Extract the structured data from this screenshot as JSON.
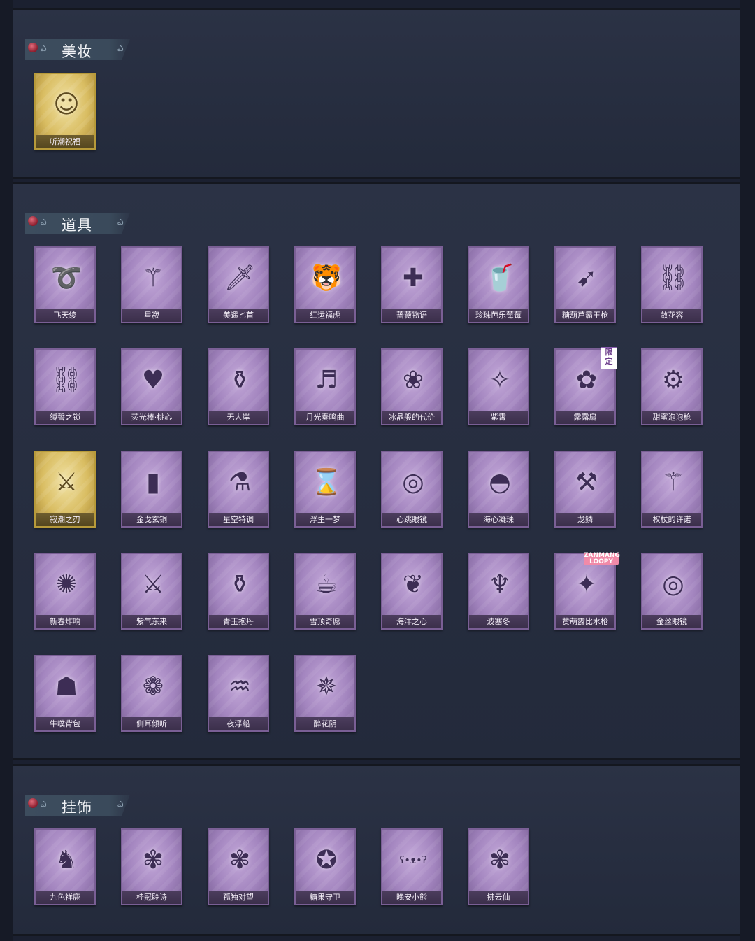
{
  "colors": {
    "background": "#1b2030",
    "panel": "#2b3245",
    "card_purple": "#a385bf",
    "card_gold": "#d9bd62"
  },
  "sections": [
    {
      "title": "美妆",
      "items": [
        {
          "name": "听潮祝福",
          "rarity": "gold",
          "icon": "face-icon"
        }
      ]
    },
    {
      "title": "道具",
      "items": [
        {
          "name": "飞天绫",
          "rarity": "purple",
          "icon": "ribbon-icon"
        },
        {
          "name": "星寂",
          "rarity": "purple",
          "icon": "scepter-icon"
        },
        {
          "name": "美遥匕首",
          "rarity": "purple",
          "icon": "dagger-icon"
        },
        {
          "name": "红运福虎",
          "rarity": "purple",
          "icon": "tiger-icon"
        },
        {
          "name": "蔷薇物语",
          "rarity": "purple",
          "icon": "medkit-icon"
        },
        {
          "name": "珍珠芭乐莓莓",
          "rarity": "purple",
          "icon": "drink-icon"
        },
        {
          "name": "糖葫芦霸王枪",
          "rarity": "purple",
          "icon": "spear-icon"
        },
        {
          "name": "敛花容",
          "rarity": "purple",
          "icon": "chain-icon"
        },
        {
          "name": "缚誓之锁",
          "rarity": "purple",
          "icon": "chain-icon"
        },
        {
          "name": "荧光棒·桃心",
          "rarity": "purple",
          "icon": "heart-wand-icon"
        },
        {
          "name": "无人岸",
          "rarity": "purple",
          "icon": "bottle-icon"
        },
        {
          "name": "月光奏鸣曲",
          "rarity": "purple",
          "icon": "piano-icon"
        },
        {
          "name": "冰晶般的代价",
          "rarity": "purple",
          "icon": "flower-icon"
        },
        {
          "name": "紫霄",
          "rarity": "purple",
          "icon": "pendant-icon"
        },
        {
          "name": "露露扇",
          "rarity": "purple",
          "icon": "fan-icon",
          "badge": "limited",
          "badge_text": [
            "限",
            "定"
          ]
        },
        {
          "name": "甜蜜泡泡枪",
          "rarity": "purple",
          "icon": "bubble-gun-icon"
        },
        {
          "name": "寂潮之刃",
          "rarity": "gold",
          "icon": "blade-icon"
        },
        {
          "name": "金戈玄铜",
          "rarity": "purple",
          "icon": "canister-icon"
        },
        {
          "name": "星空特调",
          "rarity": "purple",
          "icon": "potion-icon"
        },
        {
          "name": "浮生一梦",
          "rarity": "purple",
          "icon": "scroll-icon"
        },
        {
          "name": "心跳眼镜",
          "rarity": "purple",
          "icon": "glasses-icon"
        },
        {
          "name": "海心凝珠",
          "rarity": "purple",
          "icon": "shell-icon"
        },
        {
          "name": "龙鳞",
          "rarity": "purple",
          "icon": "shovel-icon"
        },
        {
          "name": "权杖的许诺",
          "rarity": "purple",
          "icon": "scepter-icon"
        },
        {
          "name": "新春炸响",
          "rarity": "purple",
          "icon": "firecracker-icon"
        },
        {
          "name": "紫气东来",
          "rarity": "purple",
          "icon": "sword-icon"
        },
        {
          "name": "青玉抱丹",
          "rarity": "purple",
          "icon": "vase-icon"
        },
        {
          "name": "雪顶奇愿",
          "rarity": "purple",
          "icon": "teacup-icon"
        },
        {
          "name": "海洋之心",
          "rarity": "purple",
          "icon": "necklace-icon"
        },
        {
          "name": "波塞冬",
          "rarity": "purple",
          "icon": "trident-icon"
        },
        {
          "name": "赞萌露比水枪",
          "rarity": "purple",
          "icon": "water-gun-icon",
          "badge": "loopy",
          "badge_text": [
            "ZANMANG",
            "LOOPY"
          ]
        },
        {
          "name": "金丝眼镜",
          "rarity": "purple",
          "icon": "glasses-icon"
        },
        {
          "name": "牛噗背包",
          "rarity": "purple",
          "icon": "backpack-icon"
        },
        {
          "name": "侧耳倾听",
          "rarity": "purple",
          "icon": "lotus-icon"
        },
        {
          "name": "夜浮船",
          "rarity": "purple",
          "icon": "jellyfish-icon"
        },
        {
          "name": "醉花阴",
          "rarity": "purple",
          "icon": "lantern-icon"
        }
      ]
    },
    {
      "title": "挂饰",
      "items": [
        {
          "name": "九色祥鹿",
          "rarity": "purple",
          "icon": "deer-icon"
        },
        {
          "name": "桂冠聆诗",
          "rarity": "purple",
          "icon": "charm-icon"
        },
        {
          "name": "孤独对望",
          "rarity": "purple",
          "icon": "charm-icon"
        },
        {
          "name": "糖果守卫",
          "rarity": "purple",
          "icon": "candy-icon"
        },
        {
          "name": "晚安小熊",
          "rarity": "purple",
          "icon": "bear-icon"
        },
        {
          "name": "拂云仙",
          "rarity": "purple",
          "icon": "charm-icon"
        }
      ]
    }
  ]
}
